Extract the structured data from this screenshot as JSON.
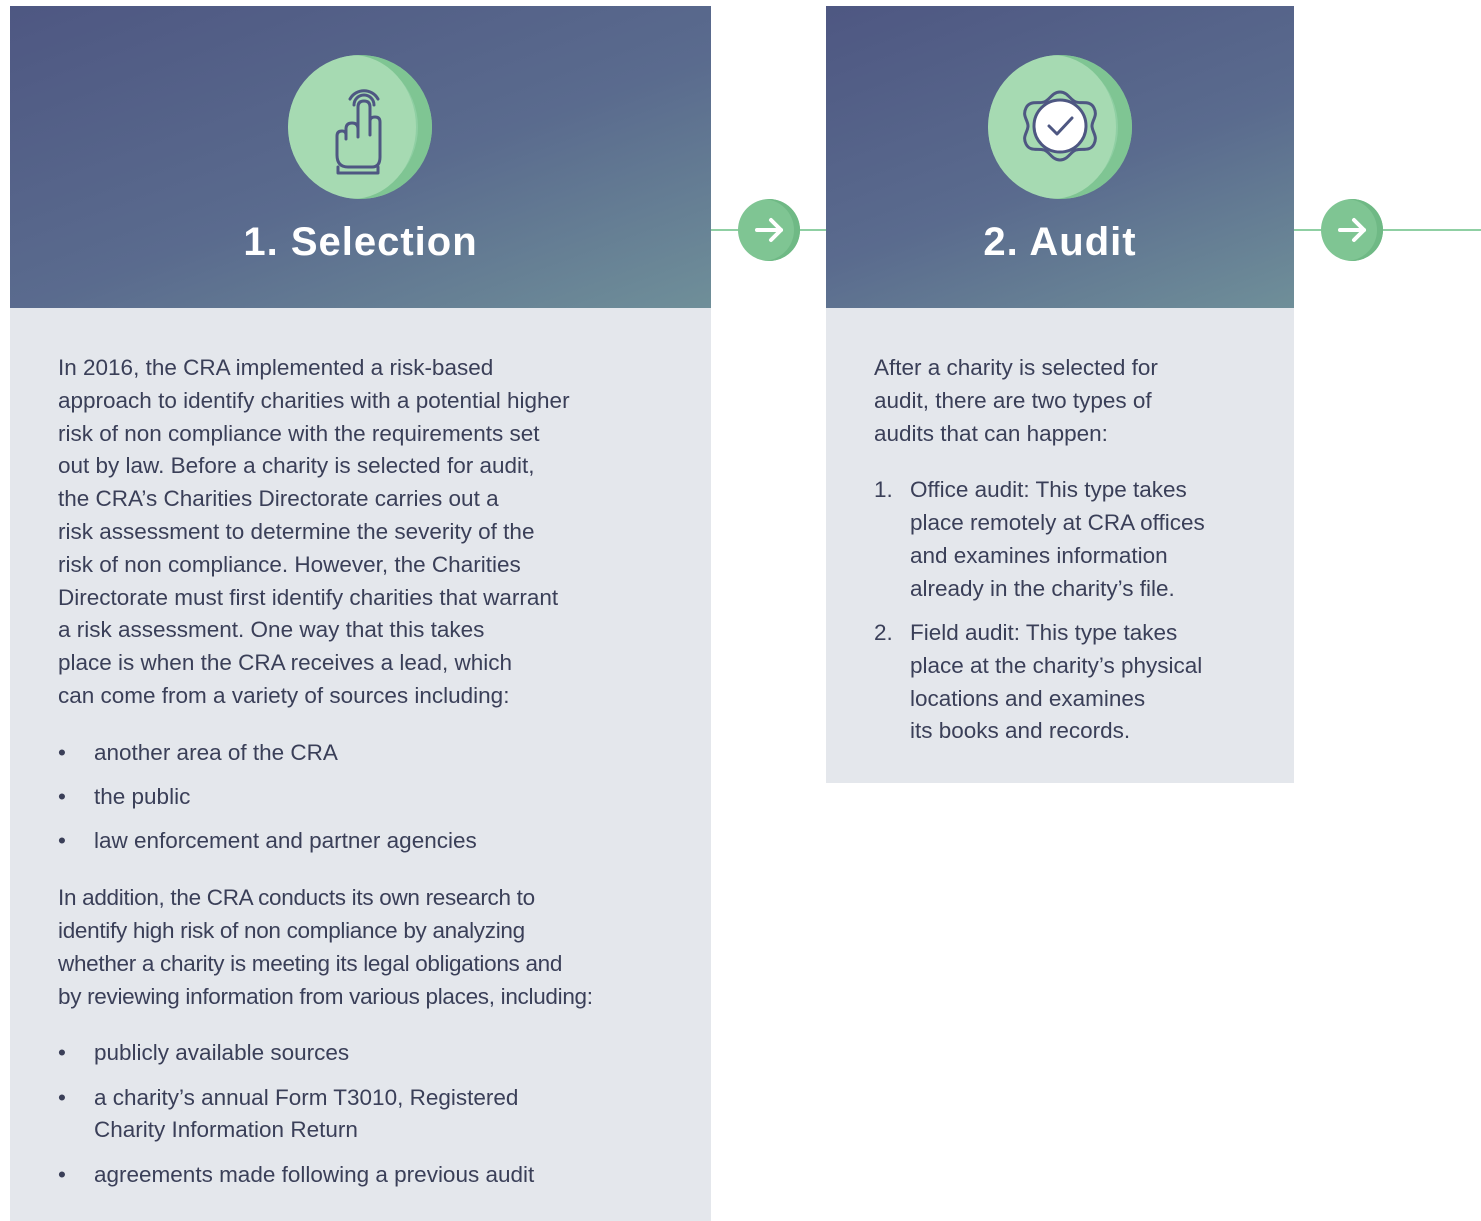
{
  "steps": [
    {
      "title": "1. Selection",
      "icon": "tap-hand-icon",
      "intro": "In 2016, the CRA implemented a risk-based approach to identify charities with a potential higher risk of non compliance with the requirements set out by law. Before a charity is selected for audit, the CRA’s Charities Directorate carries out a risk assessment to determine the severity of the risk of non compliance. However, the Charities Directorate must first identify charities that warrant a risk assessment. One way that this takes place is when the CRA receives a lead, which can come from a variety of sources including:",
      "intro_lines": [
        "In 2016, the CRA implemented a risk-based",
        "approach to identify charities with a potential higher",
        "risk of non compliance with the requirements set",
        "out by law. Before a charity is selected for audit,",
        "the CRA’s Charities Directorate carries out a",
        "risk assessment to determine the severity of the",
        "risk of non compliance. However, the Charities",
        "Directorate must first identify charities that warrant",
        "a risk assessment. One way that this takes",
        "place is when the CRA receives a lead, which",
        "can come from a variety of sources including:"
      ],
      "lead_sources": [
        "another area of the CRA",
        "the public",
        "law enforcement and partner agencies"
      ],
      "research_lines": [
        "In addition, the CRA conducts its own research to",
        "identify high risk of non compliance by analyzing",
        "whether a charity is meeting its legal obligations and",
        "by reviewing information from various places, including:"
      ],
      "research_sources": [
        [
          "publicly available sources"
        ],
        [
          "a charity’s annual Form T3010, Registered",
          "Charity Information Return"
        ],
        [
          "agreements made following a previous audit"
        ]
      ]
    },
    {
      "title": "2. Audit",
      "icon": "verified-badge-icon",
      "intro_lines": [
        "After a charity is selected for",
        "audit, there are two types of",
        "audits that can happen:"
      ],
      "audit_types": [
        {
          "num": "1.",
          "lines": [
            "Office audit: This type takes",
            "place remotely at CRA offices",
            "and examines information",
            "already in the charity’s file."
          ]
        },
        {
          "num": "2.",
          "lines": [
            "Field audit: This type takes",
            "place at the charity’s physical",
            "locations and examines",
            "its books and records."
          ]
        }
      ]
    }
  ],
  "bullet": "•",
  "arrow_icon": "arrow-right-icon",
  "colors": {
    "header_start": "#4e5782",
    "header_end": "#6f8f99",
    "accent_green": "#8fcfa3",
    "body_bg": "#e4e7ec",
    "text": "#3a3f58"
  }
}
